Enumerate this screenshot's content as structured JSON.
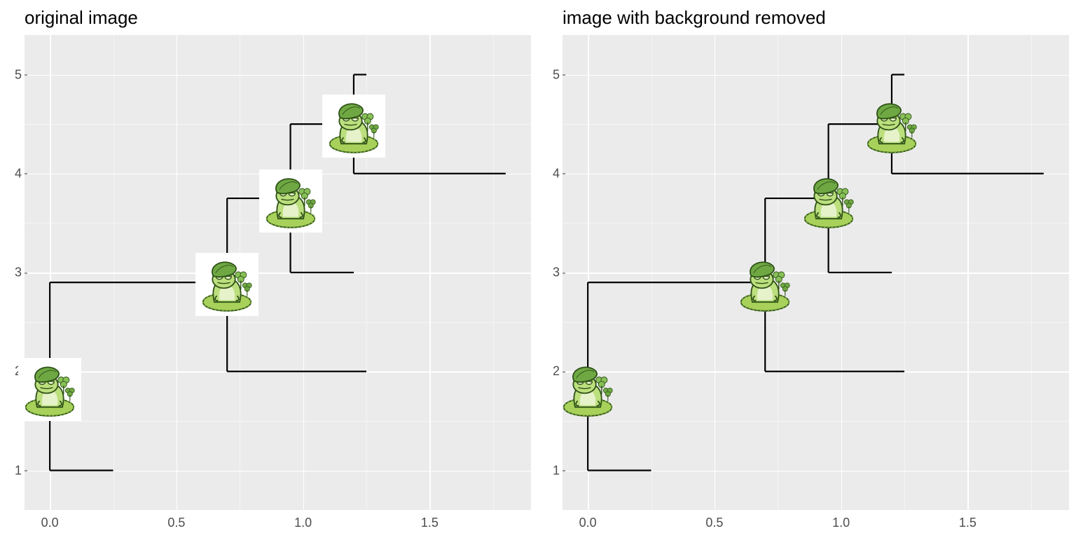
{
  "chart_data": [
    {
      "type": "dendrogram",
      "title": "original image",
      "xlim": [
        -0.1,
        1.9
      ],
      "ylim": [
        0.6,
        5.4
      ],
      "x_ticks": [
        0.0,
        0.5,
        1.0,
        1.5
      ],
      "y_ticks": [
        1,
        2,
        3,
        4,
        5
      ],
      "segments": [
        {
          "x0": 0.25,
          "y0": 1.0,
          "x1": 0.0,
          "y1": 1.0
        },
        {
          "x0": 0.7,
          "y0": 2.9,
          "x1": 0.0,
          "y1": 2.9
        },
        {
          "x0": 0.0,
          "y0": 1.0,
          "x1": 0.0,
          "y1": 2.9
        },
        {
          "x0": 0.0,
          "y0": 1.8,
          "x1": -0.05,
          "y1": 1.8
        },
        {
          "x0": 1.25,
          "y0": 2.0,
          "x1": 0.7,
          "y1": 2.0
        },
        {
          "x0": 0.95,
          "y0": 3.75,
          "x1": 0.7,
          "y1": 3.75
        },
        {
          "x0": 0.7,
          "y0": 2.0,
          "x1": 0.7,
          "y1": 3.75
        },
        {
          "x0": 0.7,
          "y0": 2.9,
          "x1": 0.65,
          "y1": 2.9
        },
        {
          "x0": 1.2,
          "y0": 3.0,
          "x1": 0.95,
          "y1": 3.0
        },
        {
          "x0": 1.2,
          "y0": 4.5,
          "x1": 0.95,
          "y1": 4.5
        },
        {
          "x0": 0.95,
          "y0": 3.0,
          "x1": 0.95,
          "y1": 4.5
        },
        {
          "x0": 0.95,
          "y0": 3.75,
          "x1": 0.9,
          "y1": 3.75
        },
        {
          "x0": 1.8,
          "y0": 4.0,
          "x1": 1.2,
          "y1": 4.0
        },
        {
          "x0": 1.25,
          "y0": 5.0,
          "x1": 1.2,
          "y1": 5.0
        },
        {
          "x0": 1.2,
          "y0": 4.0,
          "x1": 1.2,
          "y1": 5.0
        },
        {
          "x0": 1.2,
          "y0": 4.5,
          "x1": 1.15,
          "y1": 4.5
        }
      ],
      "images": [
        {
          "x": 0.0,
          "y": 1.82,
          "name": "frog-icon",
          "white_bg": true
        },
        {
          "x": 0.7,
          "y": 2.88,
          "name": "frog-icon",
          "white_bg": true
        },
        {
          "x": 0.95,
          "y": 3.72,
          "name": "frog-icon",
          "white_bg": true
        },
        {
          "x": 1.2,
          "y": 4.48,
          "name": "frog-icon",
          "white_bg": true
        }
      ]
    },
    {
      "type": "dendrogram",
      "title": "image with background removed",
      "xlim": [
        -0.1,
        1.9
      ],
      "ylim": [
        0.6,
        5.4
      ],
      "x_ticks": [
        0.0,
        0.5,
        1.0,
        1.5
      ],
      "y_ticks": [
        1,
        2,
        3,
        4,
        5
      ],
      "segments": [
        {
          "x0": 0.25,
          "y0": 1.0,
          "x1": 0.0,
          "y1": 1.0
        },
        {
          "x0": 0.7,
          "y0": 2.9,
          "x1": 0.0,
          "y1": 2.9
        },
        {
          "x0": 0.0,
          "y0": 1.0,
          "x1": 0.0,
          "y1": 2.9
        },
        {
          "x0": 0.0,
          "y0": 1.8,
          "x1": -0.05,
          "y1": 1.8
        },
        {
          "x0": 1.25,
          "y0": 2.0,
          "x1": 0.7,
          "y1": 2.0
        },
        {
          "x0": 0.95,
          "y0": 3.75,
          "x1": 0.7,
          "y1": 3.75
        },
        {
          "x0": 0.7,
          "y0": 2.0,
          "x1": 0.7,
          "y1": 3.75
        },
        {
          "x0": 0.7,
          "y0": 2.9,
          "x1": 0.65,
          "y1": 2.9
        },
        {
          "x0": 1.2,
          "y0": 3.0,
          "x1": 0.95,
          "y1": 3.0
        },
        {
          "x0": 1.2,
          "y0": 4.5,
          "x1": 0.95,
          "y1": 4.5
        },
        {
          "x0": 0.95,
          "y0": 3.0,
          "x1": 0.95,
          "y1": 4.5
        },
        {
          "x0": 0.95,
          "y0": 3.75,
          "x1": 0.9,
          "y1": 3.75
        },
        {
          "x0": 1.8,
          "y0": 4.0,
          "x1": 1.2,
          "y1": 4.0
        },
        {
          "x0": 1.25,
          "y0": 5.0,
          "x1": 1.2,
          "y1": 5.0
        },
        {
          "x0": 1.2,
          "y0": 4.0,
          "x1": 1.2,
          "y1": 5.0
        },
        {
          "x0": 1.2,
          "y0": 4.5,
          "x1": 1.15,
          "y1": 4.5
        }
      ],
      "images": [
        {
          "x": 0.0,
          "y": 1.82,
          "name": "frog-icon",
          "white_bg": false
        },
        {
          "x": 0.7,
          "y": 2.88,
          "name": "frog-icon",
          "white_bg": false
        },
        {
          "x": 0.95,
          "y": 3.72,
          "name": "frog-icon",
          "white_bg": false
        },
        {
          "x": 1.2,
          "y": 4.48,
          "name": "frog-icon",
          "white_bg": false
        }
      ]
    }
  ]
}
